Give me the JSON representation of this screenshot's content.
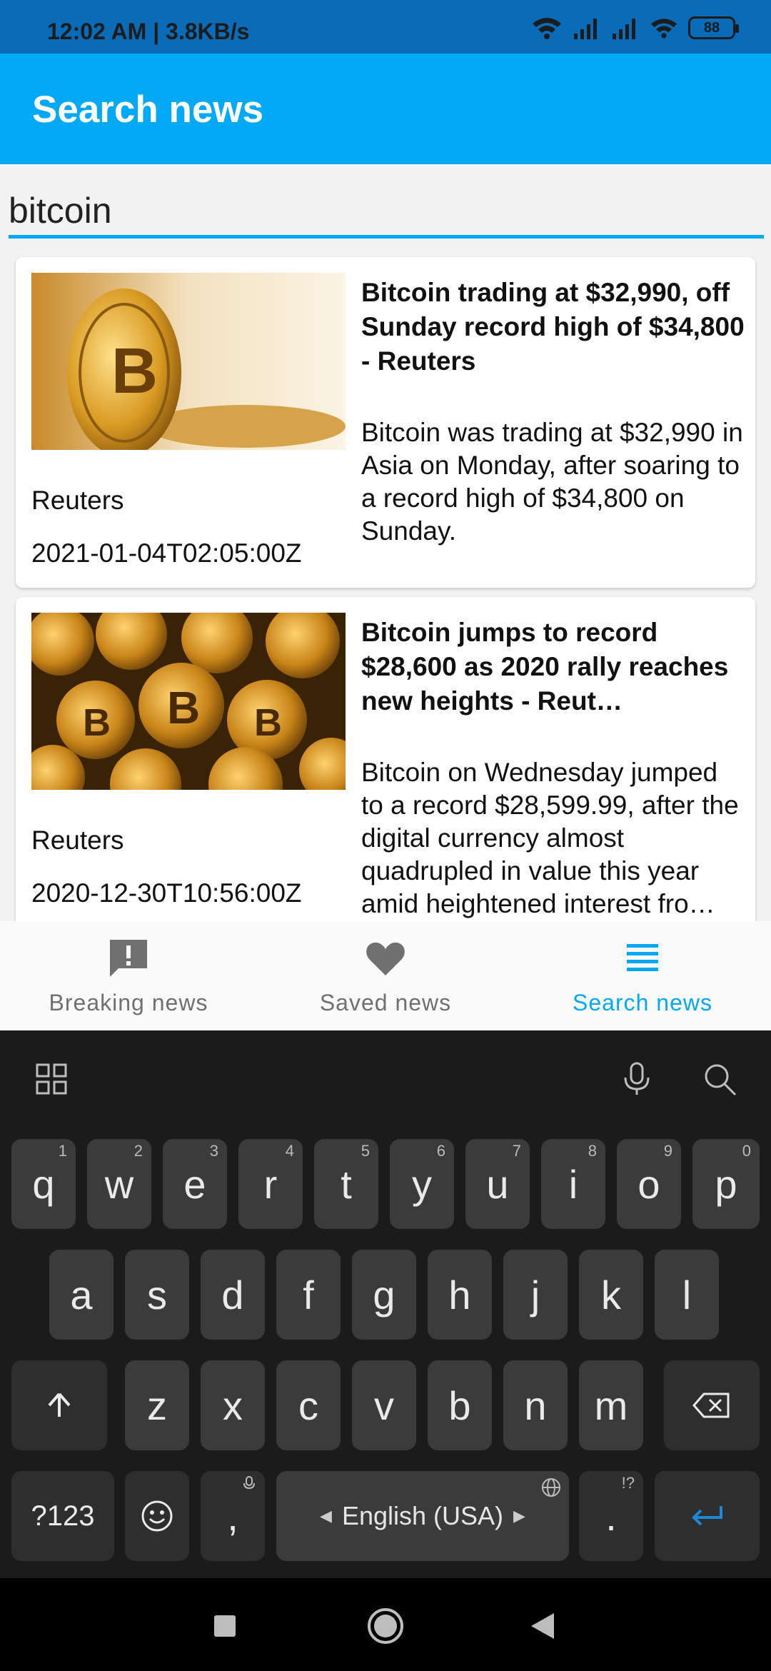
{
  "status_bar": {
    "time": "12:02 AM | 3.8KB/s",
    "battery": "88"
  },
  "app_bar": {
    "title": "Search news"
  },
  "search": {
    "value": "bitcoin"
  },
  "articles": [
    {
      "title": "Bitcoin trading at $32,990, off Sunday record high of $34,800 - Reuters",
      "description": "Bitcoin was trading at $32,990 in Asia on Monday, after soaring to a record high of $34,800 on Sunday.",
      "source": "Reuters",
      "published": "2021-01-04T02:05:00Z"
    },
    {
      "title": "Bitcoin jumps to record $28,600 as 2020 rally reaches new heights - Reut…",
      "description": "Bitcoin on Wednesday jumped to a record $28,599.99, after the digital currency almost quadrupled in value this year amid heightened interest fro…",
      "source": "Reuters",
      "published": "2020-12-30T10:56:00Z"
    }
  ],
  "bottom_nav": {
    "items": [
      {
        "label": "Breaking news",
        "icon": "breaking-news-icon"
      },
      {
        "label": "Saved news",
        "icon": "heart-icon"
      },
      {
        "label": "Search news",
        "icon": "list-icon"
      }
    ],
    "active_index": 2
  },
  "keyboard": {
    "row1": [
      {
        "key": "q",
        "hint": "1"
      },
      {
        "key": "w",
        "hint": "2"
      },
      {
        "key": "e",
        "hint": "3"
      },
      {
        "key": "r",
        "hint": "4"
      },
      {
        "key": "t",
        "hint": "5"
      },
      {
        "key": "y",
        "hint": "6"
      },
      {
        "key": "u",
        "hint": "7"
      },
      {
        "key": "i",
        "hint": "8"
      },
      {
        "key": "o",
        "hint": "9"
      },
      {
        "key": "p",
        "hint": "0"
      }
    ],
    "row2": [
      "a",
      "s",
      "d",
      "f",
      "g",
      "h",
      "j",
      "k",
      "l"
    ],
    "row3": [
      "z",
      "x",
      "c",
      "v",
      "b",
      "n",
      "m"
    ],
    "symbols_key": "?123",
    "comma_key": ",",
    "period_key": ".",
    "period_hint": "!?",
    "space_label": "English (USA)"
  },
  "colors": {
    "accent": "#03a9f4",
    "status_bar": "#0a6bb8",
    "inactive": "#707070",
    "keyboard_bg": "#1b1b1b",
    "key_bg": "#3b3b3b",
    "enter": "#1e88d6"
  }
}
